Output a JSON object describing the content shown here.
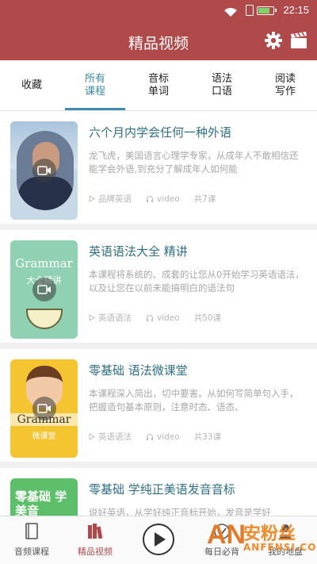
{
  "status_bar": {
    "time": "22:15",
    "battery_level": 0.7,
    "icons": [
      "wifi-icon",
      "sim-icon",
      "battery-icon"
    ]
  },
  "header": {
    "title": "精品视频",
    "icons": [
      "gear-icon",
      "clapperboard-icon"
    ]
  },
  "tabs": [
    {
      "label": "收藏"
    },
    {
      "label": "所有\n课程",
      "active": true
    },
    {
      "label": "音标\n单词"
    },
    {
      "label": "语法\n口语"
    },
    {
      "label": "阅读\n写作"
    }
  ],
  "courses": [
    {
      "title": "六个月内学会任何一种外语",
      "desc": "龙飞虎，美国语言心理学专家，从成年人不敢相信还能学会外语,到充分了解成年人如何能",
      "category": "品牌英语",
      "media": "video",
      "count": "共7课"
    },
    {
      "title": "英语语法大全 精讲",
      "desc": "本课程将系统的、成套的让您从0开始学习英语语法，以及让您在以前未能搞明白的语法句",
      "category": "英语语法",
      "media": "video",
      "count": "共50课",
      "thumb_text": "Grammar",
      "thumb_sub": "大全精讲"
    },
    {
      "title": "零基础 语法微课堂",
      "desc": "本课程深入简出，切中要害。从如何写简单句入手，把握造句基本原则，注意时态、语态、",
      "category": "英语语法",
      "media": "video",
      "count": "共33课",
      "thumb_text": "Grammar",
      "thumb_sub": "微课堂"
    },
    {
      "title": "零基础 学纯正美语发音音标",
      "desc": "说好英语，从学好纯正音标开始，发音是学好",
      "thumb_text": "零基础 学美音"
    }
  ],
  "bottom_nav": [
    {
      "label": "音频课程",
      "icon": "book-icon"
    },
    {
      "label": "精品视频",
      "icon": "books-icon",
      "active": true
    },
    {
      "label": "",
      "icon": "play-icon"
    },
    {
      "label": "每日必背",
      "icon": "check-icon"
    },
    {
      "label": "我的地盘",
      "icon": "person-icon"
    }
  ],
  "watermark": {
    "mark": "AN",
    "text_cn": "安粉丝",
    "text_en": "ANFENSI.COM"
  },
  "colors": {
    "brand": "#b04a4a",
    "accent": "#3f8aa8",
    "title": "#2f6f86"
  }
}
